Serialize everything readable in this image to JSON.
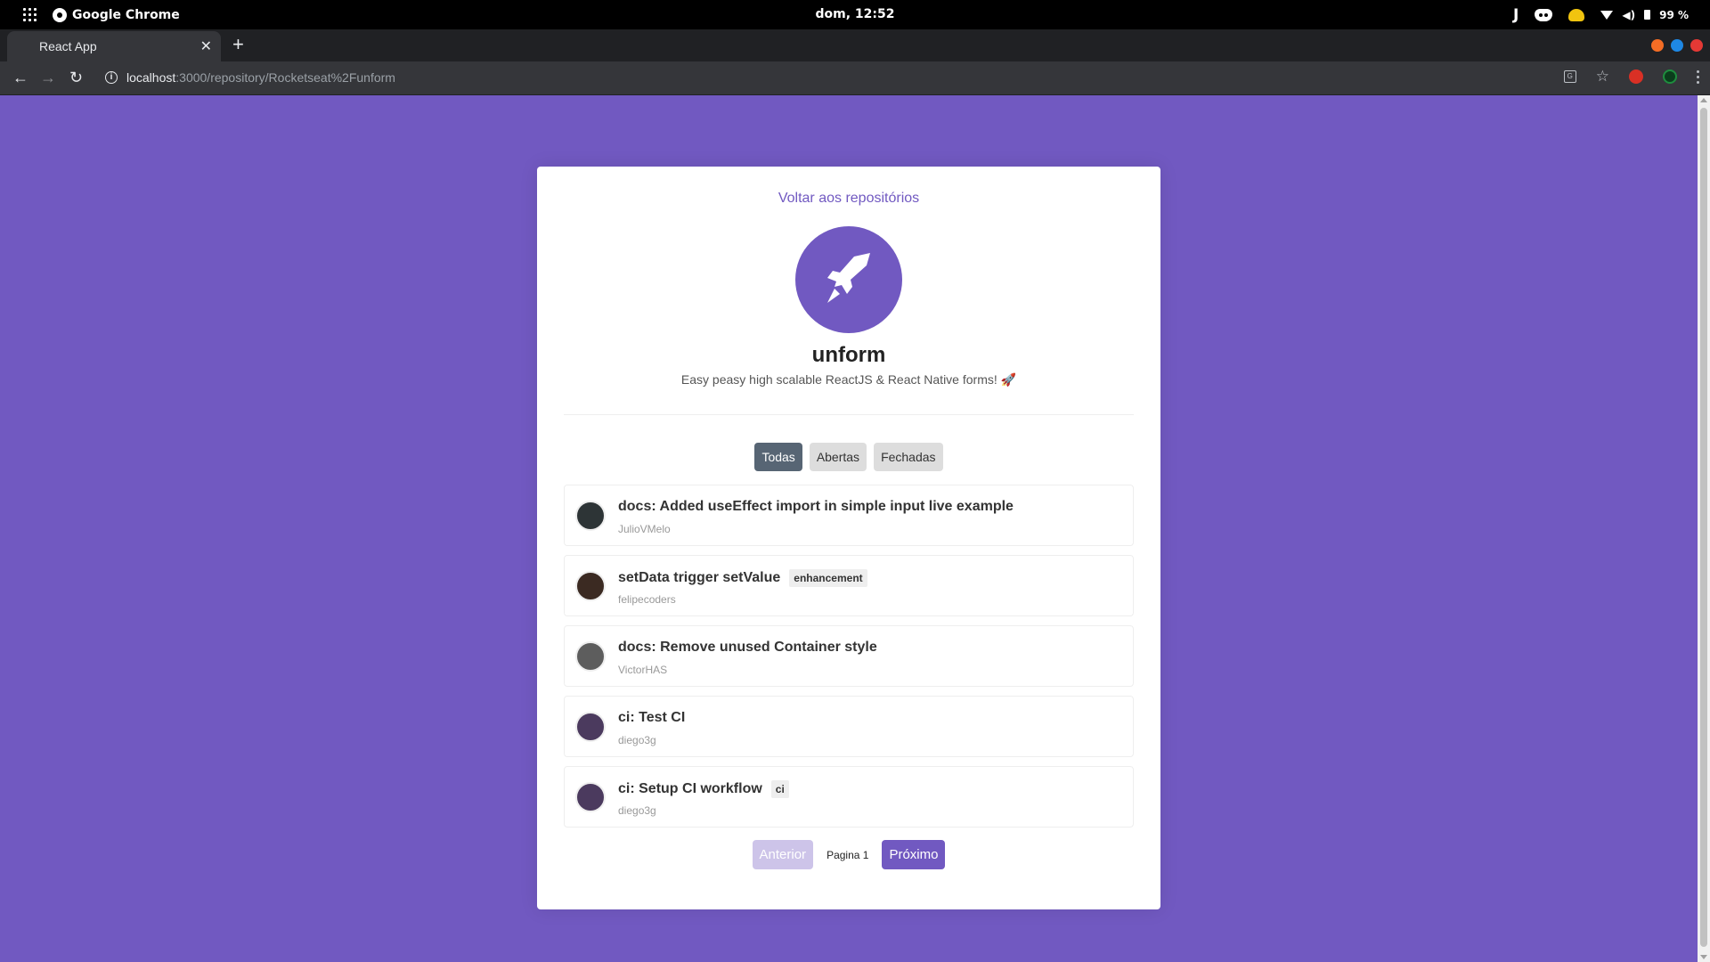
{
  "system_bar": {
    "app_name": "Google Chrome",
    "clock": "dom, 12:52",
    "battery": "99 %"
  },
  "browser": {
    "tab_title": "React App",
    "url_host": "localhost",
    "url_path": ":3000/repository/Rocketseat%2Funform",
    "window_controls_colors": [
      "#f46d25",
      "#1e88e5",
      "#e53935"
    ]
  },
  "page": {
    "back_link": "Voltar aos repositórios",
    "repo_name": "unform",
    "repo_description": "Easy peasy high scalable ReactJS & React Native forms! 🚀",
    "filters": [
      {
        "label": "Todas",
        "active": true
      },
      {
        "label": "Abertas",
        "active": false
      },
      {
        "label": "Fechadas",
        "active": false
      }
    ],
    "issues": [
      {
        "title": "docs: Added useEffect import in simple input live example",
        "login": "JulioVMelo",
        "labels": [],
        "avatar_color": "#2d3436"
      },
      {
        "title": "setData trigger setValue",
        "login": "felipecoders",
        "labels": [
          "enhancement"
        ],
        "avatar_color": "#3b2a22"
      },
      {
        "title": "docs: Remove unused Container style",
        "login": "VictorHAS",
        "labels": [],
        "avatar_color": "#5d5d5d"
      },
      {
        "title": "ci: Test CI",
        "login": "diego3g",
        "labels": [],
        "avatar_color": "#4b3a5e"
      },
      {
        "title": "ci: Setup CI workflow",
        "login": "diego3g",
        "labels": [
          "ci"
        ],
        "avatar_color": "#4b3a5e"
      }
    ],
    "pagination": {
      "prev_label": "Anterior",
      "page_label": "Pagina 1",
      "next_label": "Próximo"
    },
    "accent_color": "#7159c1"
  }
}
